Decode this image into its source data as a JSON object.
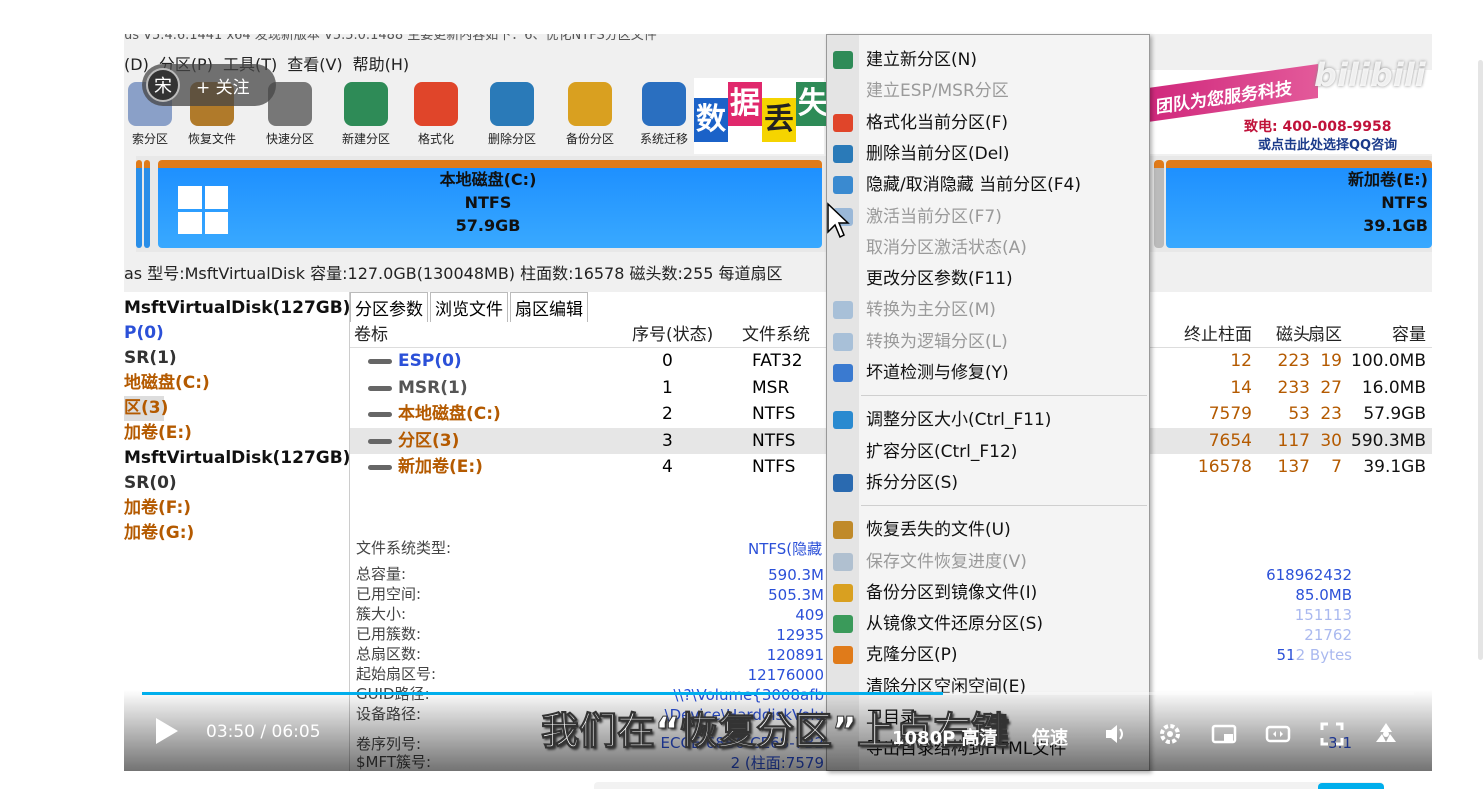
{
  "app": {
    "title_line": "us V5.4.6.1441 x64    发现新版本 V5.5.0.1488    主要更新内容如下：6、优化NTFS分区文件",
    "menu": [
      "(D)",
      "分区(P)",
      "工具(T)",
      "查看(V)",
      "帮助(H)"
    ]
  },
  "follow": {
    "label": "+ 关注",
    "avatar": "宋"
  },
  "toolbar": [
    {
      "label": "索分区",
      "icon": "search-partition-icon",
      "color": "#8aa0c8"
    },
    {
      "label": "恢复文件",
      "icon": "recover-file-icon",
      "color": "#b07a2a"
    },
    {
      "label": "快速分区",
      "icon": "quick-partition-icon",
      "color": "#777777"
    },
    {
      "label": "新建分区",
      "icon": "new-partition-icon",
      "color": "#2e8b57"
    },
    {
      "label": "格式化",
      "icon": "format-icon",
      "color": "#e0452a"
    },
    {
      "label": "删除分区",
      "icon": "delete-partition-icon",
      "color": "#2a7ab8"
    },
    {
      "label": "备份分区",
      "icon": "backup-partition-icon",
      "color": "#d9a020"
    },
    {
      "label": "系统迁移",
      "icon": "system-migrate-icon",
      "color": "#2a6fc0"
    }
  ],
  "ad": {
    "slogan": "团队为您服务科技",
    "phone": "致电: 400-008-9958",
    "qq": "或点击此处选择QQ咨询",
    "banner_chars": [
      "数",
      "据",
      "丢",
      "失"
    ]
  },
  "bilibili_logo": "bilibili",
  "disk_bar": {
    "c": {
      "name": "本地磁盘(C:)",
      "fs": "NTFS",
      "size": "57.9GB"
    },
    "e": {
      "name": "新加卷(E:)",
      "fs": "NTFS",
      "size": "39.1GB"
    }
  },
  "disk_info": "as  型号:MsftVirtualDisk  容量:127.0GB(130048MB)  柱面数:16578  磁头数:255  每道扇区",
  "tree": [
    {
      "text": "MsftVirtualDisk(127GB)",
      "kind": "disk"
    },
    {
      "text": "P(0)",
      "kind": "blue"
    },
    {
      "text": "SR(1)",
      "kind": "gray"
    },
    {
      "text": "地磁盘(C:)",
      "kind": "brown"
    },
    {
      "text": "区(3)",
      "kind": "brown-sel"
    },
    {
      "text": "加卷(E:)",
      "kind": "brown"
    },
    {
      "text": "MsftVirtualDisk(127GB)",
      "kind": "disk"
    },
    {
      "text": "SR(0)",
      "kind": "gray"
    },
    {
      "text": "加卷(F:)",
      "kind": "brown"
    },
    {
      "text": "加卷(G:)",
      "kind": "brown"
    }
  ],
  "tabs": [
    "分区参数",
    "浏览文件",
    "扇区编辑"
  ],
  "table": {
    "headers": {
      "volume": "卷标",
      "index": "序号(状态)",
      "fs": "文件系统",
      "end_cyl": "终止柱面",
      "head": "磁头",
      "sector": "扇区",
      "capacity": "容量"
    },
    "rows": [
      {
        "volume": "ESP(0)",
        "index": "0",
        "fs": "FAT32",
        "end_cyl": "12",
        "head": "223",
        "sector": "19",
        "capacity": "100.0MB",
        "color": "#2b50d8"
      },
      {
        "volume": "MSR(1)",
        "index": "1",
        "fs": "MSR",
        "end_cyl": "14",
        "head": "233",
        "sector": "27",
        "capacity": "16.0MB",
        "color": "#555555"
      },
      {
        "volume": "本地磁盘(C:)",
        "index": "2",
        "fs": "NTFS",
        "end_cyl": "7579",
        "head": "53",
        "sector": "23",
        "capacity": "57.9GB",
        "color": "#b45a00"
      },
      {
        "volume": "分区(3)",
        "index": "3",
        "fs": "NTFS",
        "end_cyl": "7654",
        "head": "117",
        "sector": "30",
        "capacity": "590.3MB",
        "color": "#b45a00"
      },
      {
        "volume": "新加卷(E:)",
        "index": "4",
        "fs": "NTFS",
        "end_cyl": "16578",
        "head": "137",
        "sector": "7",
        "capacity": "39.1GB",
        "color": "#b45a00"
      }
    ]
  },
  "props": {
    "fs_type_label": "文件系统类型:",
    "fs_type_value": "NTFS(隐藏",
    "labels": [
      "总容量:",
      "已用空间:",
      "簇大小:",
      "已用簇数:",
      "总扇区数:",
      "起始扇区号:",
      "GUID路径:",
      "设备路径:"
    ],
    "values": [
      "590.3M",
      "505.3M",
      "409",
      "12935",
      "120891",
      "12176000",
      "\\\\?\\Volume{3008afb",
      "\\Device\\HarddiskVolu"
    ],
    "right_values": [
      "618962432",
      "85.0MB",
      "151113",
      "21762",
      "512 Bytes"
    ],
    "serial_label": "卷序列号:",
    "serial_value": "ECCE-68B6-CE68-7B2",
    "mft_label": "$MFT簇号:",
    "mft_value": "2 (柱面:7579",
    "extra_right": "3.1"
  },
  "context_menu": [
    {
      "label": "建立新分区(N)",
      "enabled": true,
      "icon": "new-partition-icon",
      "color": "#2e8b57"
    },
    {
      "label": "建立ESP/MSR分区",
      "enabled": false,
      "icon": "",
      "color": ""
    },
    {
      "label": "格式化当前分区(F)",
      "enabled": true,
      "icon": "format-icon",
      "color": "#e0452a"
    },
    {
      "label": "删除当前分区(Del)",
      "enabled": true,
      "icon": "delete-icon",
      "color": "#2a7ab8"
    },
    {
      "label": "隐藏/取消隐藏 当前分区(F4)",
      "enabled": true,
      "icon": "hide-icon",
      "color": "#3a8ad0"
    },
    {
      "label": "激活当前分区(F7)",
      "enabled": false,
      "icon": "activate-icon",
      "color": "#9ab8d8"
    },
    {
      "label": "取消分区激活状态(A)",
      "enabled": false,
      "icon": "",
      "color": ""
    },
    {
      "label": "更改分区参数(F11)",
      "enabled": true,
      "icon": "",
      "color": ""
    },
    {
      "label": "转换为主分区(M)",
      "enabled": false,
      "icon": "convert-primary-icon",
      "color": "#a8c0d8"
    },
    {
      "label": "转换为逻辑分区(L)",
      "enabled": false,
      "icon": "convert-logical-icon",
      "color": "#a8c0d8"
    },
    {
      "label": "坏道检测与修复(Y)",
      "enabled": true,
      "icon": "repair-icon",
      "color": "#3a7ad0"
    },
    {
      "label": "调整分区大小(Ctrl_F11)",
      "enabled": true,
      "icon": "resize-icon",
      "color": "#2a8ad0"
    },
    {
      "label": "扩容分区(Ctrl_F12)",
      "enabled": true,
      "icon": "",
      "color": ""
    },
    {
      "label": "拆分分区(S)",
      "enabled": true,
      "icon": "split-icon",
      "color": "#2a6ab0"
    },
    {
      "label": "恢复丢失的文件(U)",
      "enabled": true,
      "icon": "recover-icon",
      "color": "#c08a2a"
    },
    {
      "label": "保存文件恢复进度(V)",
      "enabled": false,
      "icon": "save-icon",
      "color": "#b0c0d0"
    },
    {
      "label": "备份分区到镜像文件(I)",
      "enabled": true,
      "icon": "backup-icon",
      "color": "#d9a020"
    },
    {
      "label": "从镜像文件还原分区(S)",
      "enabled": true,
      "icon": "restore-icon",
      "color": "#3a9a5a"
    },
    {
      "label": "克隆分区(P)",
      "enabled": true,
      "icon": "clone-icon",
      "color": "#e07b1a"
    },
    {
      "label": "清除分区空闲空间(E)",
      "enabled": true,
      "icon": "",
      "color": ""
    },
    {
      "label": "卫目录",
      "enabled": true,
      "icon": "",
      "color": ""
    },
    {
      "label": "导出目录结构到HTML文件",
      "enabled": true,
      "icon": "",
      "color": ""
    }
  ],
  "player": {
    "time": "03:50 / 06:05",
    "progress": 0.63,
    "subtitle": "我们在“恢复分区”上点右键",
    "quality": "1080P 高清",
    "speed": "倍速",
    "accent": "#00aeec"
  }
}
